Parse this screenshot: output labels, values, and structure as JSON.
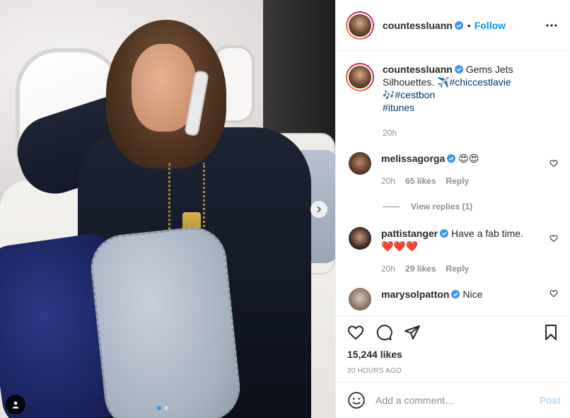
{
  "post": {
    "username": "countessluann",
    "follow_label": "Follow",
    "separator": "•",
    "caption": {
      "text": "Gems Jets Silhouettes. ✈️",
      "tag1": "#chiccestlavie",
      "tag2_prefix": "🎶",
      "tag2": "#cestbon",
      "tag3": "#itunes",
      "time": "20h"
    },
    "carousel": {
      "current": 1,
      "total": 2
    }
  },
  "comments": [
    {
      "username": "melissagorga",
      "text": "😍😍",
      "time": "20h",
      "likes": "65 likes",
      "reply_label": "Reply",
      "replies_label": "View replies (1)"
    },
    {
      "username": "pattistanger",
      "text": "Have a fab time. ❤️❤️❤️",
      "time": "20h",
      "likes": "29 likes",
      "reply_label": "Reply"
    },
    {
      "username": "marysolpatton",
      "text": "Nice"
    }
  ],
  "actions": {
    "likes": "15,244 likes",
    "time_ago": "20 HOURS AGO"
  },
  "add_comment": {
    "placeholder": "Add a comment…",
    "post_label": "Post"
  },
  "colors": {
    "link": "#0095f6",
    "hashtag": "#00376b",
    "muted": "#8e8e8e",
    "post_disabled": "#b2dffc"
  },
  "icons": [
    "chevron-right-icon",
    "user-tag-icon",
    "verified-icon",
    "more-icon",
    "heart-icon",
    "comment-icon",
    "share-icon",
    "bookmark-icon",
    "emoji-icon"
  ]
}
